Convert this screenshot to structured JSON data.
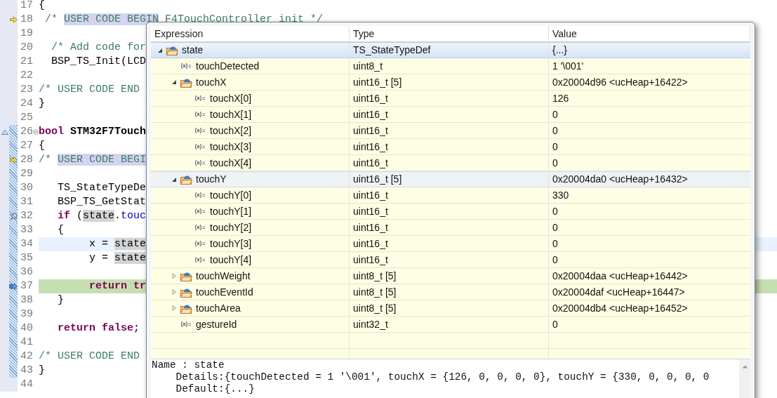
{
  "editor": {
    "lines": [
      {
        "number": "17",
        "kind": "plain",
        "annotated": false,
        "tokens": [
          {
            "text": "{",
            "kind": "plain"
          }
        ]
      },
      {
        "number": "18",
        "kind": "arrow",
        "annotated": false,
        "tokens": [
          {
            "text": " /* ",
            "kind": "comment"
          },
          {
            "text": "USER CODE BEGIN",
            "kind": "comment-mark"
          },
          {
            "text": " F4TouchController_init */",
            "kind": "comment"
          }
        ]
      },
      {
        "number": "19",
        "kind": "plain",
        "annotated": false
      },
      {
        "number": "20",
        "kind": "plain",
        "annotated": false,
        "tokens": [
          {
            "text": "  /* Add code for",
            "kind": "comment"
          }
        ]
      },
      {
        "number": "21",
        "kind": "plain",
        "annotated": false,
        "tokens": [
          {
            "text": "  BSP_TS_Init(LCD",
            "kind": "plain"
          }
        ]
      },
      {
        "number": "22",
        "kind": "plain",
        "annotated": false
      },
      {
        "number": "23",
        "kind": "plain",
        "annotated": false,
        "tokens": [
          {
            "text": "/* USER CODE END",
            "kind": "comment"
          }
        ]
      },
      {
        "number": "24",
        "kind": "plain",
        "annotated": false,
        "tokens": [
          {
            "text": "}",
            "kind": "plain"
          }
        ]
      },
      {
        "number": "25",
        "kind": "plain",
        "annotated": false
      },
      {
        "number": "26",
        "kind": "fold",
        "annotated": true,
        "tokens": [
          {
            "text": "bool",
            "kind": "keyword"
          },
          {
            "text": " STM32F7Touch",
            "kind": "name"
          }
        ]
      },
      {
        "number": "27",
        "kind": "plain",
        "annotated": true,
        "tokens": [
          {
            "text": "{",
            "kind": "plain"
          }
        ]
      },
      {
        "number": "28",
        "kind": "arrow",
        "annotated": true,
        "tokens": [
          {
            "text": "/* ",
            "kind": "comment"
          },
          {
            "text": "USER CODE BEGI",
            "kind": "comment-mark"
          }
        ]
      },
      {
        "number": "29",
        "kind": "plain",
        "annotated": true
      },
      {
        "number": "30",
        "kind": "plain",
        "annotated": true,
        "tokens": [
          {
            "text": "   TS_StateTypeDe",
            "kind": "plain"
          }
        ]
      },
      {
        "number": "31",
        "kind": "plain",
        "annotated": true,
        "tokens": [
          {
            "text": "   BSP_TS_GetStat",
            "kind": "plain"
          }
        ]
      },
      {
        "number": "32",
        "kind": "search",
        "annotated": true,
        "tokens": [
          {
            "text": "   if",
            "kind": "keyword"
          },
          {
            "text": " (",
            "kind": "plain"
          },
          {
            "text": "state",
            "kind": "mark"
          },
          {
            "text": ".",
            "kind": "plain"
          },
          {
            "text": "touc",
            "kind": "field"
          }
        ]
      },
      {
        "number": "33",
        "kind": "plain",
        "annotated": true,
        "tokens": [
          {
            "text": "   {",
            "kind": "plain"
          }
        ]
      },
      {
        "number": "34",
        "kind": "plain",
        "annotated": true,
        "current_line": true,
        "tokens": [
          {
            "text": "        x = ",
            "kind": "plain"
          },
          {
            "text": "state",
            "kind": "mark"
          }
        ]
      },
      {
        "number": "35",
        "kind": "plain",
        "annotated": true,
        "tokens": [
          {
            "text": "        y = ",
            "kind": "plain"
          },
          {
            "text": "state",
            "kind": "mark"
          }
        ]
      },
      {
        "number": "36",
        "kind": "plain",
        "annotated": true
      },
      {
        "number": "37",
        "kind": "instruction",
        "annotated": true,
        "executing": true,
        "tokens": [
          {
            "text": "        return tr",
            "kind": "keyword"
          }
        ]
      },
      {
        "number": "38",
        "kind": "plain",
        "annotated": true,
        "tokens": [
          {
            "text": "   }",
            "kind": "plain"
          }
        ]
      },
      {
        "number": "39",
        "kind": "plain",
        "annotated": true
      },
      {
        "number": "40",
        "kind": "plain",
        "annotated": true,
        "tokens": [
          {
            "text": "   return false",
            "kind": "keyword"
          },
          {
            "text": ";",
            "kind": "plain"
          }
        ]
      },
      {
        "number": "41",
        "kind": "plain",
        "annotated": true
      },
      {
        "number": "42",
        "kind": "plain",
        "annotated": true,
        "tokens": [
          {
            "text": "/* USER CODE END",
            "kind": "comment"
          }
        ]
      },
      {
        "number": "43",
        "kind": "plain",
        "annotated": true,
        "tokens": [
          {
            "text": "}",
            "kind": "plain"
          }
        ]
      },
      {
        "number": "44",
        "kind": "plain",
        "annotated": false
      }
    ]
  },
  "expressions": {
    "columns": [
      "Expression",
      "Type",
      "Value"
    ],
    "rows": [
      {
        "expression": "state",
        "type": "TS_StateTypeDef",
        "value": "{...}",
        "kind": "struct",
        "expanded": true,
        "selected": true,
        "hovered": false,
        "children": [
          {
            "expression": "touchDetected",
            "type": "uint8_t",
            "value": "1 '\\001'",
            "kind": "variable",
            "selected": false,
            "hovered": false
          },
          {
            "expression": "touchX",
            "type": "uint16_t [5]",
            "value": "0x20004d96 <ucHeap+16422>",
            "kind": "struct",
            "expanded": true,
            "selected": false,
            "hovered": false,
            "children": [
              {
                "expression": "touchX[0]",
                "type": "uint16_t",
                "value": "126",
                "kind": "variable",
                "selected": false,
                "hovered": false
              },
              {
                "expression": "touchX[1]",
                "type": "uint16_t",
                "value": "0",
                "kind": "variable",
                "selected": false,
                "hovered": false
              },
              {
                "expression": "touchX[2]",
                "type": "uint16_t",
                "value": "0",
                "kind": "variable",
                "selected": false,
                "hovered": false
              },
              {
                "expression": "touchX[3]",
                "type": "uint16_t",
                "value": "0",
                "kind": "variable",
                "selected": false,
                "hovered": false
              },
              {
                "expression": "touchX[4]",
                "type": "uint16_t",
                "value": "0",
                "kind": "variable",
                "selected": false,
                "hovered": false
              }
            ]
          },
          {
            "expression": "touchY",
            "type": "uint16_t [5]",
            "value": "0x20004da0 <ucHeap+16432>",
            "kind": "struct",
            "expanded": true,
            "selected": false,
            "hovered": true,
            "children": [
              {
                "expression": "touchY[0]",
                "type": "uint16_t",
                "value": "330",
                "kind": "variable",
                "selected": false,
                "hovered": false
              },
              {
                "expression": "touchY[1]",
                "type": "uint16_t",
                "value": "0",
                "kind": "variable",
                "selected": false,
                "hovered": false
              },
              {
                "expression": "touchY[2]",
                "type": "uint16_t",
                "value": "0",
                "kind": "variable",
                "selected": false,
                "hovered": false
              },
              {
                "expression": "touchY[3]",
                "type": "uint16_t",
                "value": "0",
                "kind": "variable",
                "selected": false,
                "hovered": false
              },
              {
                "expression": "touchY[4]",
                "type": "uint16_t",
                "value": "0",
                "kind": "variable",
                "selected": false,
                "hovered": false
              }
            ]
          },
          {
            "expression": "touchWeight",
            "type": "uint8_t [5]",
            "value": "0x20004daa <ucHeap+16442>",
            "kind": "struct",
            "expanded": false,
            "selected": false,
            "hovered": false
          },
          {
            "expression": "touchEventId",
            "type": "uint8_t [5]",
            "value": "0x20004daf <ucHeap+16447>",
            "kind": "struct",
            "expanded": false,
            "selected": false,
            "hovered": false
          },
          {
            "expression": "touchArea",
            "type": "uint8_t [5]",
            "value": "0x20004db4 <ucHeap+16452>",
            "kind": "struct",
            "expanded": false,
            "selected": false,
            "hovered": false
          },
          {
            "expression": "gestureId",
            "type": "uint32_t",
            "value": "0",
            "kind": "variable",
            "selected": false,
            "hovered": false
          }
        ]
      }
    ],
    "details": [
      "Name : state",
      "    Details:{touchDetected = 1 '\\001', touchX = {126, 0, 0, 0, 0}, touchY = {330, 0, 0, 0, 0",
      "    Default:{...}"
    ]
  }
}
